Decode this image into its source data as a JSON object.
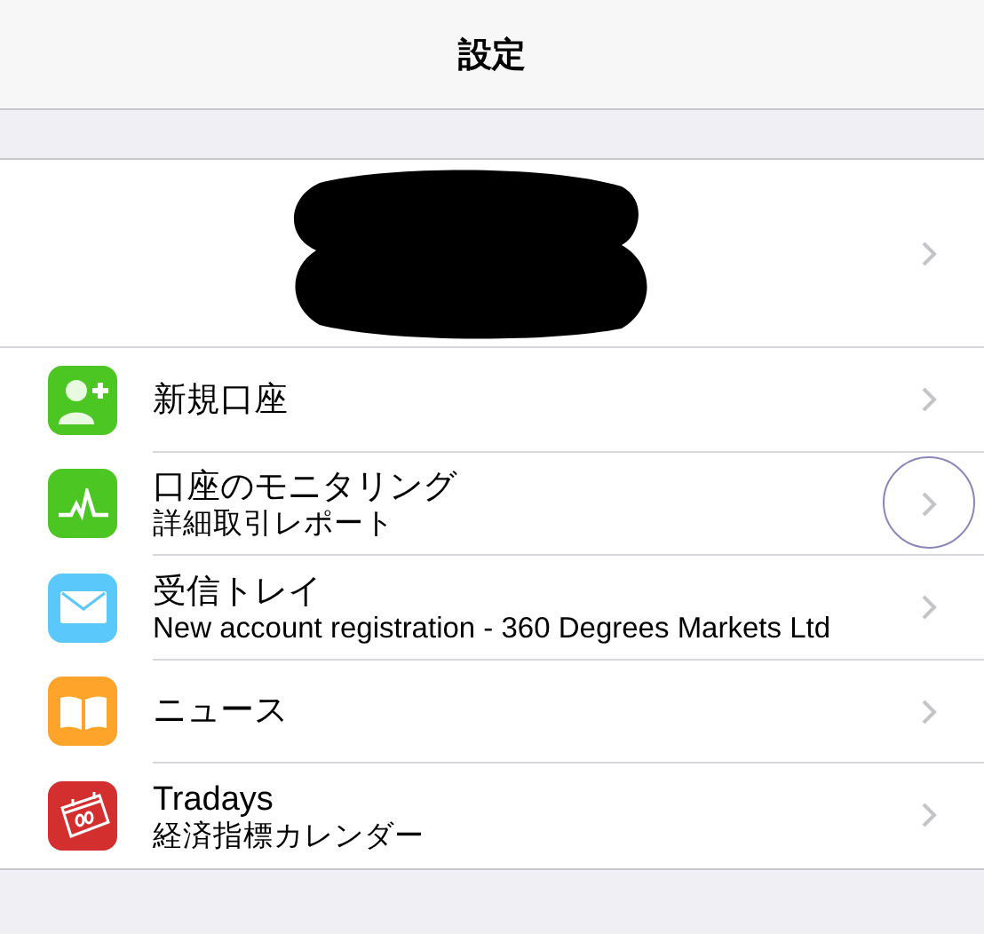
{
  "nav_bar": {
    "title": "設定"
  },
  "account": {
    "redacted": true
  },
  "items": [
    {
      "kind": "person-add",
      "color": "#4cc622",
      "title": "新規口座",
      "touched": false
    },
    {
      "kind": "chart",
      "color": "#4cc622",
      "title": "口座のモニタリング",
      "subtitle": "詳細取引レポート",
      "touched": true
    },
    {
      "kind": "mail",
      "color": "#5ac8fa",
      "title": "受信トレイ",
      "subtitle": "New account registration - 360 Degrees Markets Ltd",
      "touched": false
    },
    {
      "kind": "book",
      "color": "#ffa42a",
      "title": "ニュース",
      "touched": false
    },
    {
      "kind": "calendar",
      "color": "#d32f2f",
      "title": "Tradays",
      "subtitle": "経済指標カレンダー",
      "touched": false
    }
  ]
}
